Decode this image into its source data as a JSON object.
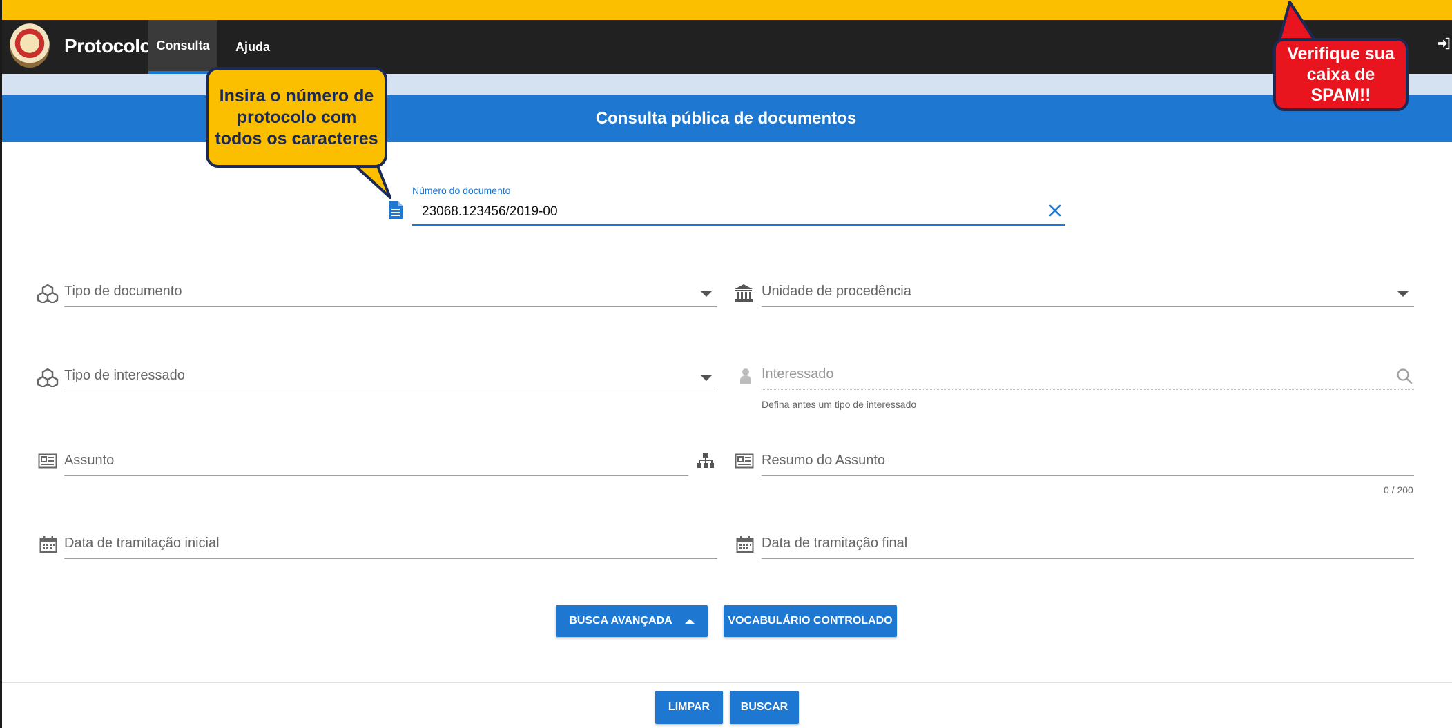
{
  "topbar": {
    "app_name": "Protocolo",
    "tabs": [
      {
        "label": "Consulta",
        "active": true
      },
      {
        "label": "Ajuda",
        "active": false
      }
    ],
    "login_icon": "sign-in-icon"
  },
  "page": {
    "title": "Consulta pública de documentos"
  },
  "form": {
    "document_number": {
      "label": "Número do documento",
      "value": "23068.123456/2019-00",
      "icon": "file-document-icon",
      "clear_icon": "close-icon"
    },
    "tipo_documento": {
      "placeholder": "Tipo de documento",
      "icon": "cubes-icon"
    },
    "unidade_procedencia": {
      "placeholder": "Unidade de procedência",
      "icon": "institution-icon"
    },
    "tipo_interessado": {
      "placeholder": "Tipo de interessado",
      "icon": "cubes-icon"
    },
    "interessado": {
      "placeholder": "Interessado",
      "hint": "Defina antes um tipo de interessado",
      "icon": "user-icon"
    },
    "assunto": {
      "placeholder": "Assunto",
      "icon": "newspaper-icon",
      "tree_icon": "sitemap-icon"
    },
    "resumo_assunto": {
      "placeholder": "Resumo do Assunto",
      "counter": "0 / 200",
      "icon": "newspaper-icon"
    },
    "data_inicial": {
      "placeholder": "Data de tramitação inicial",
      "icon": "calendar-icon"
    },
    "data_final": {
      "placeholder": "Data de tramitação final",
      "icon": "calendar-icon"
    }
  },
  "buttons": {
    "busca_avancada": "BUSCA AVANÇADA",
    "vocabulario": "VOCABULÁRIO CONTROLADO",
    "limpar": "LIMPAR",
    "buscar": "BUSCAR"
  },
  "callouts": {
    "protocolo_hint": "Insira o número de protocolo com todos os caracteres",
    "spam_warning": "Verifique sua caixa de SPAM!!"
  },
  "colors": {
    "primary": "#1e77d0",
    "topbar": "#212121",
    "annotation_yellow": "#fbbf00",
    "annotation_red": "#e8141e"
  }
}
